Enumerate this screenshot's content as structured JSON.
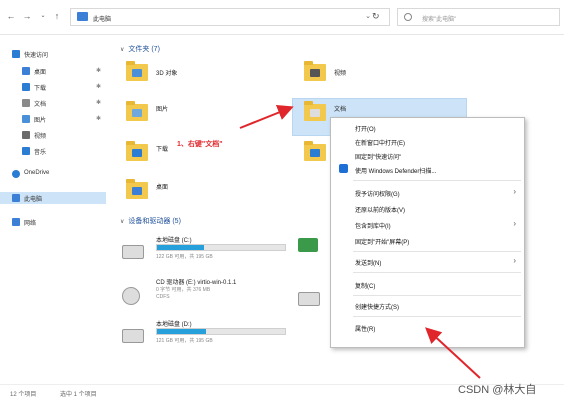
{
  "address": {
    "path": "此电脑",
    "search_placeholder": "搜索\"此电脑\""
  },
  "sidebar": {
    "items": [
      {
        "label": "快速访问",
        "color": "#2b7cd3",
        "pin": ""
      },
      {
        "label": "桌面",
        "color": "#3b80d6",
        "pin": "✱"
      },
      {
        "label": "下载",
        "color": "#2b7cd3",
        "pin": "✱"
      },
      {
        "label": "文档",
        "color": "#8a8a8a",
        "pin": "✱"
      },
      {
        "label": "图片",
        "color": "#4a90d9",
        "pin": "✱"
      },
      {
        "label": "视频",
        "color": "#6b6b6b",
        "pin": ""
      },
      {
        "label": "音乐",
        "color": "#2b7cd3",
        "pin": ""
      },
      {
        "label": "OneDrive",
        "color": "#2b7cd3",
        "pin": ""
      },
      {
        "label": "此电脑",
        "color": "#3b80d6",
        "pin": ""
      },
      {
        "label": "网络",
        "color": "#3b80d6",
        "pin": ""
      }
    ]
  },
  "groups": {
    "folders": "文件夹 (7)",
    "devices": "设备和驱动器 (5)"
  },
  "folders": [
    {
      "label": "3D 对象",
      "overlay": "#4a90d9"
    },
    {
      "label": "视频",
      "overlay": "#555555"
    },
    {
      "label": "图片",
      "overlay": "#6fa8dc"
    },
    {
      "label": "文档",
      "overlay": "#dddddd"
    },
    {
      "label": "下载",
      "overlay": "#2b7cd3"
    },
    {
      "label": "音乐",
      "overlay": "#2b7cd3"
    },
    {
      "label": "桌面",
      "overlay": "#3b80d6"
    }
  ],
  "drives": [
    {
      "name": "本地磁盘 (C:)",
      "sub": "122 GB 可用，共 195 GB",
      "fill": 0.37
    },
    {
      "name": "CD 驱动器 (E:) virtio-win-0.1.1",
      "sub": "0 字节 可用，共 376 MB",
      "sub2": "CDFS"
    },
    {
      "name": "本地磁盘 (D:)",
      "sub": "121 GB 可用，共 195 GB",
      "fill": 0.38
    }
  ],
  "menu": {
    "items": [
      {
        "label": "打开(O)"
      },
      {
        "label": "在新窗口中打开(E)"
      },
      {
        "label": "固定到\"快速访问\""
      },
      {
        "label": "使用 Windows Defender扫描...",
        "icon": true
      },
      {
        "label": "授予访问权限(G)",
        "arrow": true
      },
      {
        "label": "还原以前的版本(V)"
      },
      {
        "label": "包含到库中(I)",
        "arrow": true
      },
      {
        "label": "固定到\"开始\"屏幕(P)"
      },
      {
        "label": "发送到(N)",
        "arrow": true
      },
      {
        "label": "复制(C)"
      },
      {
        "label": "创建快捷方式(S)"
      },
      {
        "label": "属性(R)"
      }
    ]
  },
  "annotation": "1、右键\"文档\"",
  "status": {
    "count": "12 个项目",
    "selected": "选中 1 个项目"
  },
  "watermark": "CSDN @林大自"
}
